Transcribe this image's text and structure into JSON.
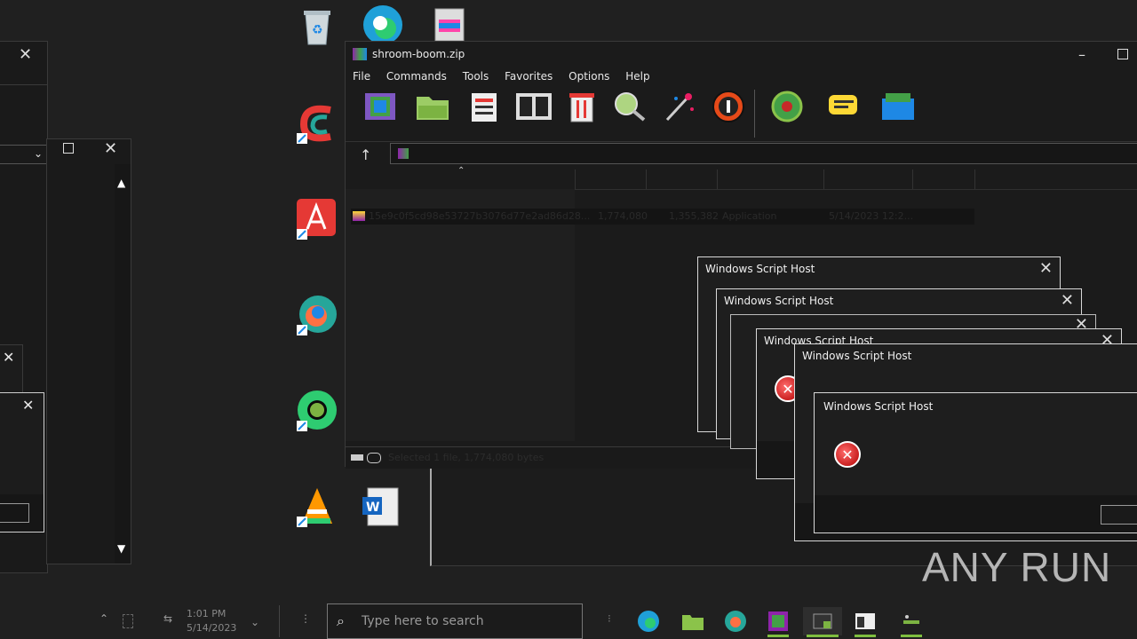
{
  "archive_window": {
    "title": "shroom-boom.zip",
    "menu": [
      "File",
      "Commands",
      "Tools",
      "Favorites",
      "Options",
      "Help"
    ],
    "file_row": {
      "name": "15e9c0f5cd98e53727b3076d77e2ad86d28...",
      "size": "1,774,080",
      "packed": "1,355,382",
      "type": "Application",
      "modified": "5/14/2023 12:2..."
    },
    "status": "Selected 1 file, 1,774,080 bytes"
  },
  "dialogs": [
    {
      "title": "Windows Script Host"
    },
    {
      "title": "Windows Script Host"
    },
    {
      "title": "Windows Script Host"
    },
    {
      "title": "Windows Script Host"
    },
    {
      "title": "Windows Script Host"
    }
  ],
  "taskbar": {
    "search_placeholder": "Type here to search",
    "clock_time": "1:01 PM",
    "clock_date": "5/14/2023"
  },
  "watermark": "ANY RUN",
  "colors": {
    "accent_underline": "#7fbf3f",
    "error_red": "#c00000"
  }
}
